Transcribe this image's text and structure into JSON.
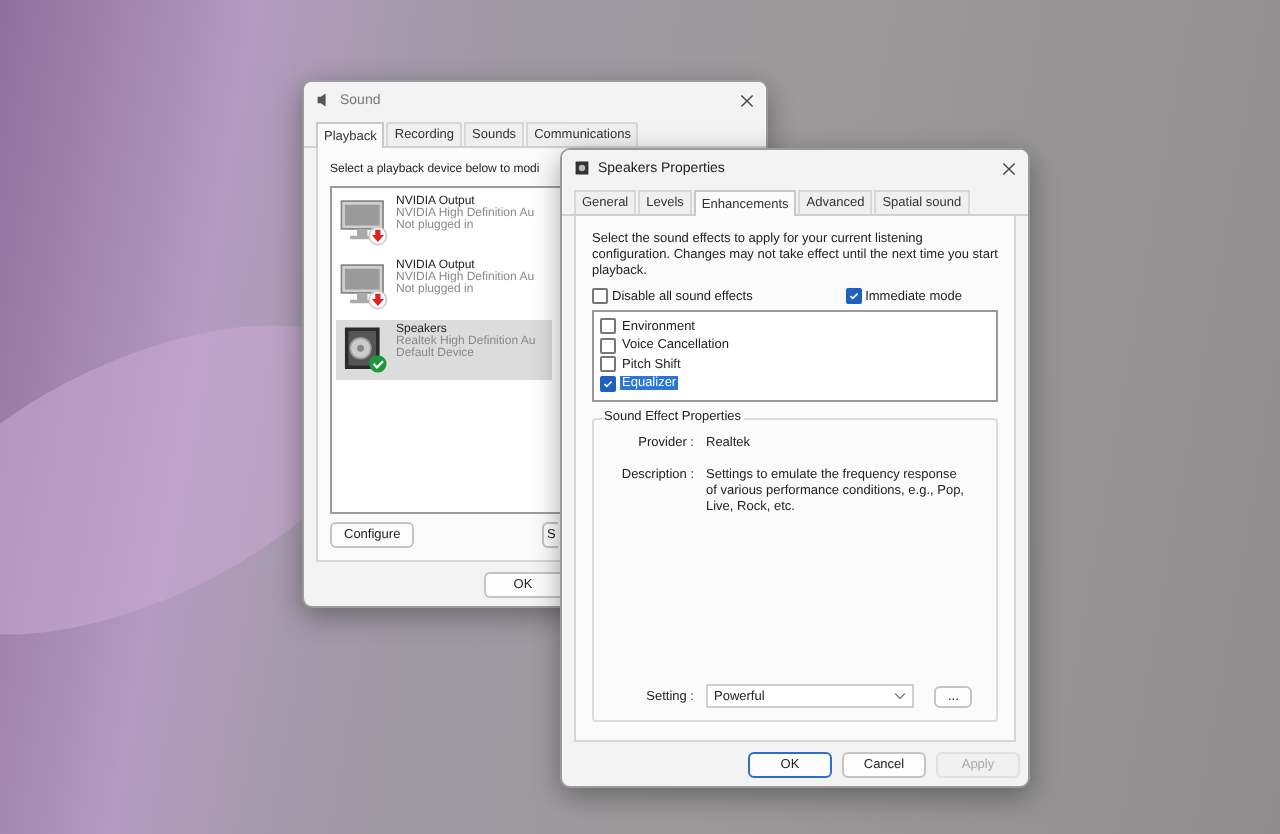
{
  "sound_window": {
    "title": "Sound",
    "tabs": [
      {
        "label": "Playback",
        "selected": true
      },
      {
        "label": "Recording",
        "selected": false
      },
      {
        "label": "Sounds",
        "selected": false
      },
      {
        "label": "Communications",
        "selected": false
      }
    ],
    "instruction": "Select a playback device below to modi",
    "devices": [
      {
        "name": "NVIDIA Output",
        "description": "NVIDIA High Definition Au",
        "status": "Not plugged in",
        "kind": "monitor",
        "is_default": false,
        "selected": false
      },
      {
        "name": "NVIDIA Output",
        "description": "NVIDIA High Definition Au",
        "status": "Not plugged in",
        "kind": "monitor",
        "is_default": false,
        "selected": false
      },
      {
        "name": "Speakers",
        "description": "Realtek High Definition Au",
        "status": "Default Device",
        "kind": "speaker",
        "is_default": true,
        "selected": true
      }
    ],
    "configure_button": "Configure",
    "set_default_button": "S",
    "ok_button": "OK"
  },
  "properties_window": {
    "title": "Speakers Properties",
    "tabs": [
      {
        "label": "General",
        "selected": false
      },
      {
        "label": "Levels",
        "selected": false
      },
      {
        "label": "Enhancements",
        "selected": true
      },
      {
        "label": "Advanced",
        "selected": false
      },
      {
        "label": "Spatial sound",
        "selected": false
      }
    ],
    "intro": "Select the sound effects to apply for your current listening configuration. Changes may not take effect until the next time you start playback.",
    "disable_all": {
      "label": "Disable all sound effects",
      "checked": false
    },
    "immediate_mode": {
      "label": "Immediate mode",
      "checked": true
    },
    "effects": [
      {
        "label": "Environment",
        "checked": false,
        "selected": false
      },
      {
        "label": "Voice Cancellation",
        "checked": false,
        "selected": false
      },
      {
        "label": "Pitch Shift",
        "checked": false,
        "selected": false
      },
      {
        "label": "Equalizer",
        "checked": true,
        "selected": true
      }
    ],
    "group": {
      "title": "Sound Effect Properties",
      "provider_label": "Provider :",
      "provider": "Realtek",
      "description_label": "Description :",
      "description": "Settings to emulate the frequency response of various performance conditions,  e.g., Pop, Live, Rock, etc.",
      "setting_label": "Setting :",
      "setting_value": "Powerful",
      "more_button": "..."
    },
    "buttons": [
      {
        "label": "OK",
        "kind": "default",
        "disabled": false
      },
      {
        "label": "Cancel",
        "kind": "normal",
        "disabled": false
      },
      {
        "label": "Apply",
        "kind": "normal",
        "disabled": true
      }
    ]
  }
}
